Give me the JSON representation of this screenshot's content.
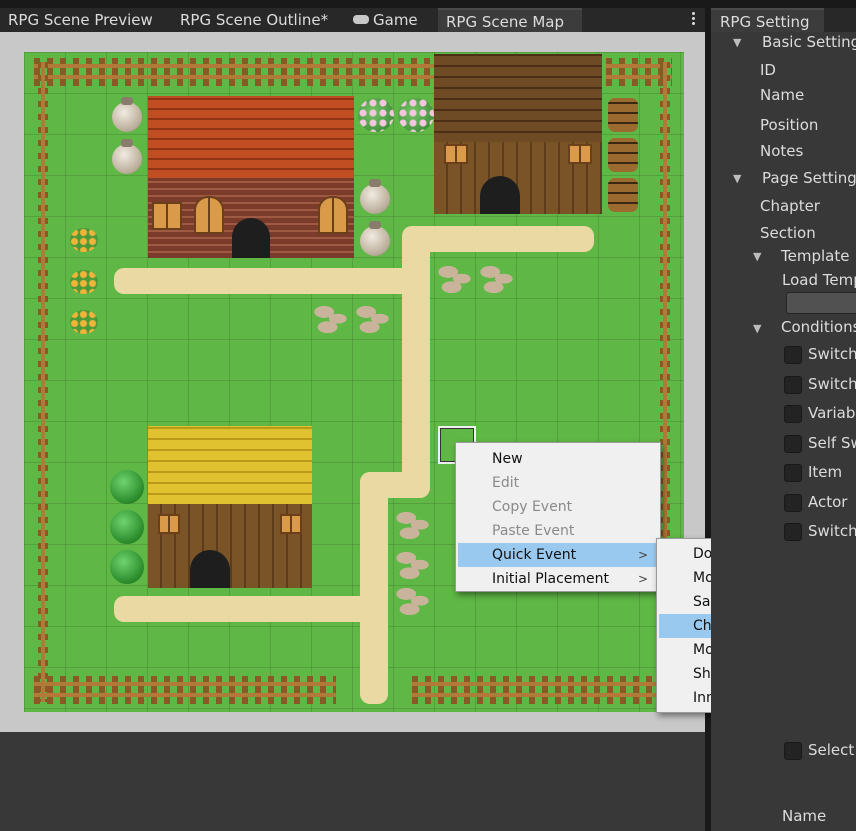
{
  "tabs": [
    {
      "label": "RPG Scene Preview",
      "active": false
    },
    {
      "label": "RPG Scene Outline*",
      "active": false
    },
    {
      "label": "Game",
      "icon": "gamepad-icon",
      "active": false
    },
    {
      "label": "RPG Scene Map",
      "active": true
    }
  ],
  "context_menu": {
    "items": [
      {
        "label": "New",
        "enabled": true
      },
      {
        "label": "Edit",
        "enabled": false
      },
      {
        "label": "Copy Event",
        "enabled": false
      },
      {
        "label": "Paste Event",
        "enabled": false
      },
      {
        "label": "Quick Event",
        "enabled": true,
        "submenu": true,
        "highlighted": true
      },
      {
        "label": "Initial Placement",
        "enabled": true,
        "submenu": true
      }
    ]
  },
  "submenu": {
    "items": [
      {
        "label": "Door"
      },
      {
        "label": "Move"
      },
      {
        "label": "Save Point"
      },
      {
        "label": "Chest",
        "highlighted": true
      },
      {
        "label": "Monster Chest"
      },
      {
        "label": "Shop"
      },
      {
        "label": "Inn"
      }
    ]
  },
  "inspector": {
    "tab_label": "RPG Setting",
    "basic_settings": "Basic Settings",
    "id": "ID",
    "name": "Name",
    "position": "Position",
    "notes": "Notes",
    "page_settings": "Page Settings",
    "chapter": "Chapter",
    "section": "Section",
    "template": "Template",
    "load_template": "Load Template",
    "conditions": "Conditions",
    "conditions_items": [
      "Switch",
      "Switch",
      "Variable",
      "Self Switch",
      "Item",
      "Actor",
      "Switch"
    ],
    "select": "Select",
    "name_bottom": "Name"
  },
  "colors": {
    "menu_highlight": "#99c9ef",
    "grass": "#5fb845",
    "path": "#ead9a2"
  }
}
